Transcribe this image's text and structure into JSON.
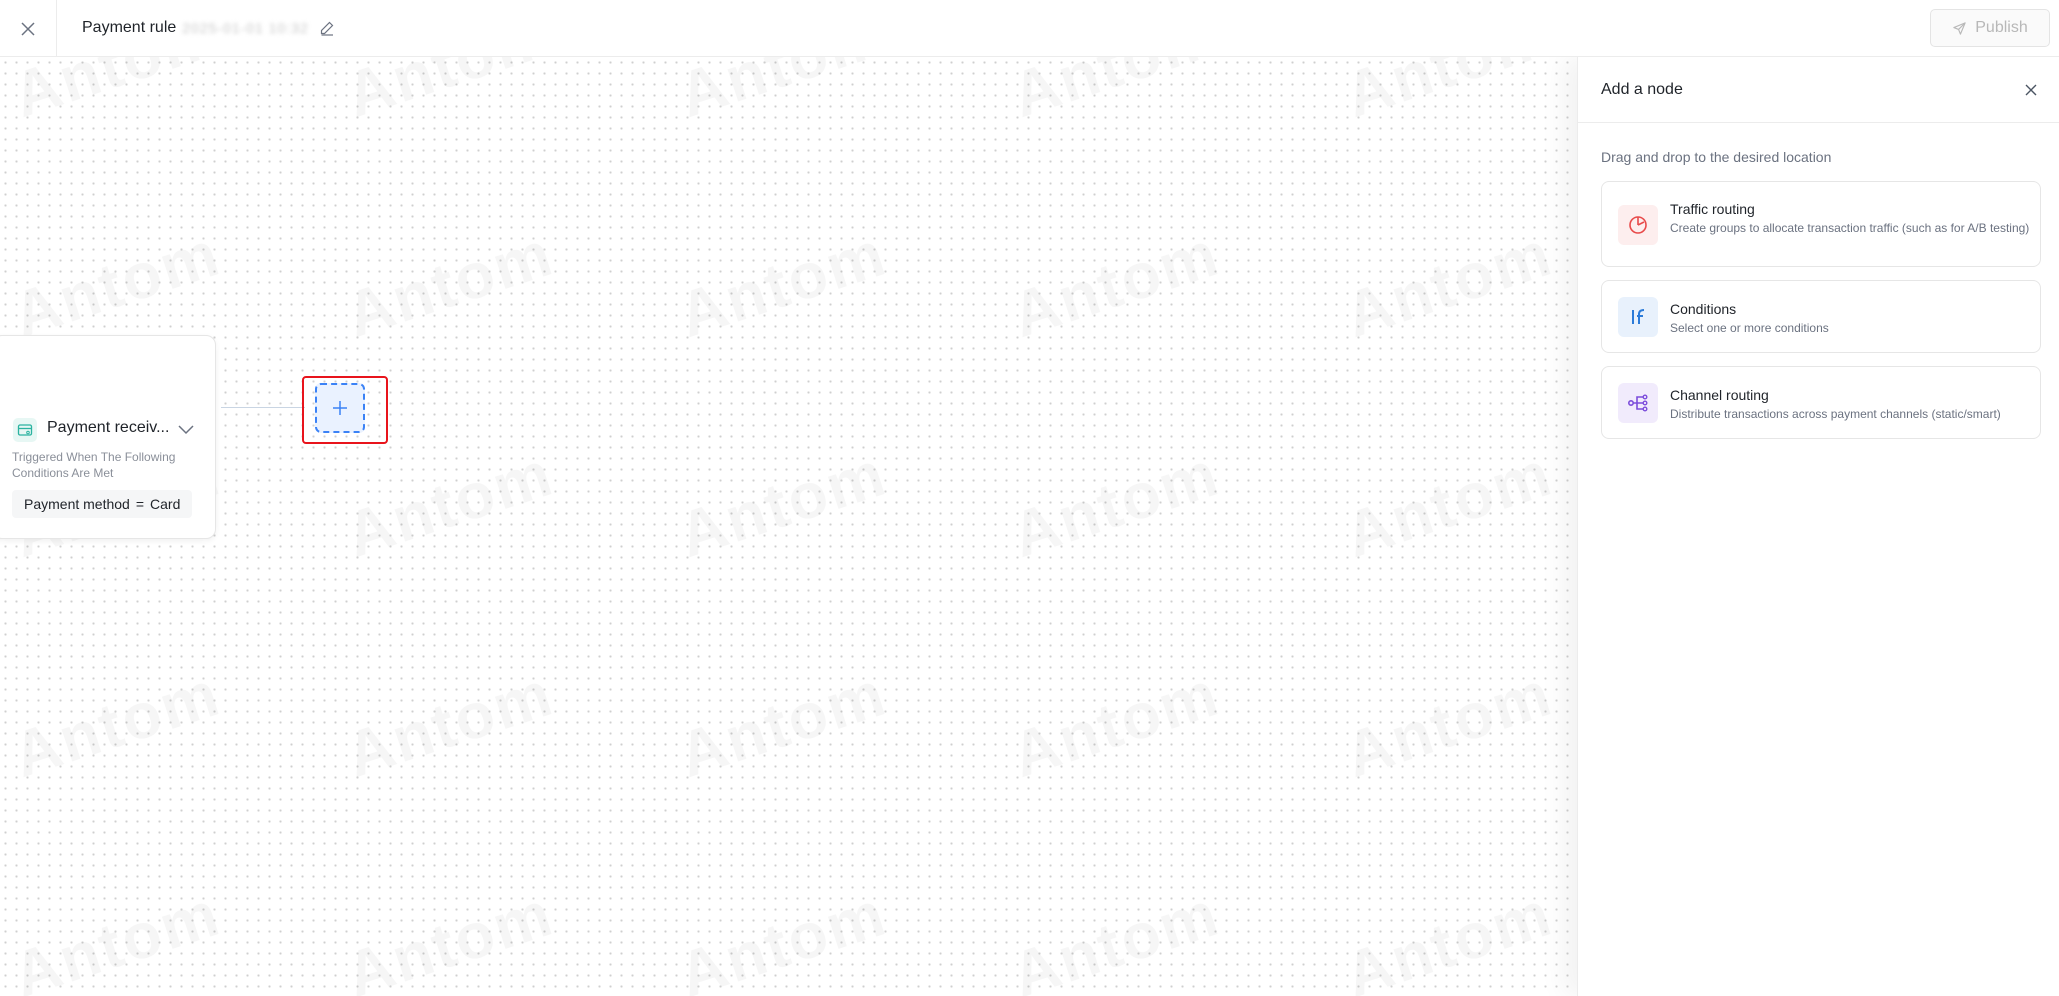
{
  "header": {
    "title": "Payment rule",
    "title_suffix_redacted": "2025-01-01 10:32",
    "publish_label": "Publish"
  },
  "canvas": {
    "watermark": "Antom",
    "trigger_card": {
      "title": "Payment receiv...",
      "description": "Triggered When The Following Conditions Are Met",
      "condition": {
        "field": "Payment method",
        "operator": "=",
        "value": "Card"
      }
    }
  },
  "panel": {
    "title": "Add a node",
    "hint": "Drag and drop to the desired location",
    "nodes": [
      {
        "title": "Traffic routing",
        "description": "Create groups to allocate transaction traffic (such as for A/B testing)",
        "icon": "pie-chart-icon",
        "color": "#e84a4a"
      },
      {
        "title": "Conditions",
        "description": "Select one or more conditions",
        "icon": "if-icon",
        "color": "#2b7bd9"
      },
      {
        "title": "Channel routing",
        "description": "Distribute transactions across payment channels (static/smart)",
        "icon": "branch-icon",
        "color": "#7c4ddb"
      }
    ]
  },
  "colors": {
    "highlight": "#e8141c",
    "accent": "#3b82f6",
    "teal": "#2bb3a0"
  }
}
